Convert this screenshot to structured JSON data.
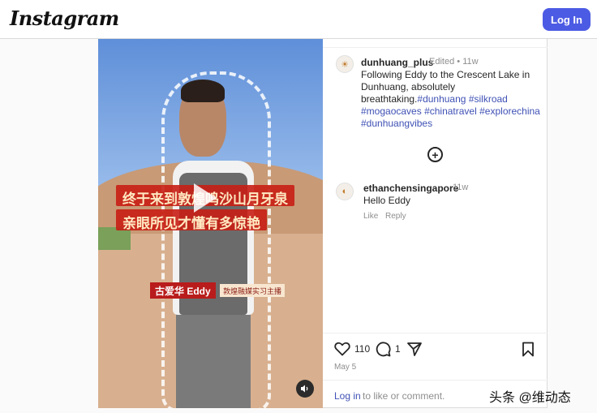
{
  "header": {
    "logo": "Instagram",
    "login_label": "Log In"
  },
  "media": {
    "caption_line1": "终于来到敦煌鸣沙山月牙泉",
    "caption_line2": "亲眼所见才懂有多惊艳",
    "name_tag": "古爱华 Eddy",
    "name_subtitle": "敦煌融媒实习主播",
    "audio_icon": "speaker-icon"
  },
  "post": {
    "username": "dunhuang_plus",
    "edited": "Edited",
    "separator": "•",
    "time": "11w",
    "caption_text": "Following Eddy to the Crescent Lake in Dunhuang, absolutely breathtaking.",
    "hashtags": [
      "#dunhuang",
      "#silkroad",
      "#mogaocaves",
      "#chinatravel",
      "#explorechina",
      "#dunhuangvibes"
    ],
    "likes": "110",
    "comments": "1",
    "date": "May 5"
  },
  "comment": {
    "username": "ethanchensingapore",
    "time": "11w",
    "text": "Hello Eddy",
    "like_label": "Like",
    "reply_label": "Reply"
  },
  "footer": {
    "login_link": "Log in",
    "rest": "to like or comment."
  },
  "watermark": "头条 @维动态",
  "colors": {
    "accent": "#4c5be4",
    "link": "#3f51b5"
  }
}
